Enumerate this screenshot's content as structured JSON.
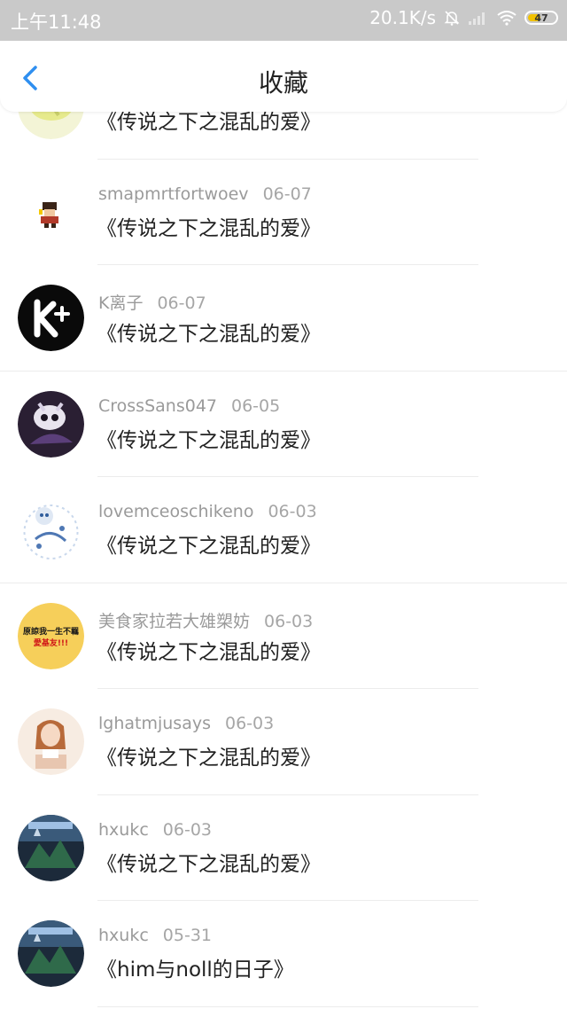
{
  "status_bar": {
    "time": "上午11:48",
    "net_speed": "20.1K/s",
    "battery": "47",
    "battery_color": "#f2c200"
  },
  "header": {
    "title": "收藏",
    "back_icon": "chevron-left-icon",
    "accent": "#2f8ff0"
  },
  "items": [
    {
      "user": "",
      "date": "",
      "work": "《传说之下之混乱的爱》"
    },
    {
      "user": "smapmrtfortwoev",
      "date": "06-07",
      "work": "《传说之下之混乱的爱》"
    },
    {
      "user": "K离子",
      "date": "06-07",
      "work": "《传说之下之混乱的爱》"
    },
    {
      "user": "CrossSans047",
      "date": "06-05",
      "work": "《传说之下之混乱的爱》"
    },
    {
      "user": "lovemceoschikeno",
      "date": "06-03",
      "work": "《传说之下之混乱的爱》"
    },
    {
      "user": "美食家拉若大雄槊妨",
      "date": "06-03",
      "work": "《传说之下之混乱的爱》",
      "avatar_text": [
        "原諒我一生不羈",
        "愛基友!!!"
      ]
    },
    {
      "user": "lghatmjusays",
      "date": "06-03",
      "work": "《传说之下之混乱的爱》"
    },
    {
      "user": "hxukc",
      "date": "06-03",
      "work": "《传说之下之混乱的爱》"
    },
    {
      "user": "hxukc",
      "date": "05-31",
      "work": "《him与noll的日子》"
    }
  ]
}
